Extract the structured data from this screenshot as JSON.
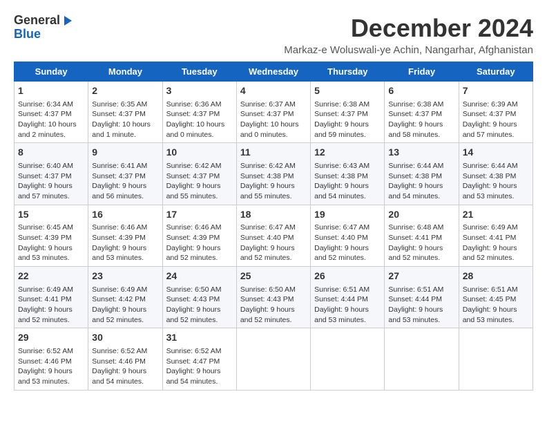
{
  "logo": {
    "general": "General",
    "blue": "Blue"
  },
  "header": {
    "month": "December 2024",
    "subtitle": "Markaz-e Woluswali-ye Achin, Nangarhar, Afghanistan"
  },
  "weekdays": [
    "Sunday",
    "Monday",
    "Tuesday",
    "Wednesday",
    "Thursday",
    "Friday",
    "Saturday"
  ],
  "weeks": [
    [
      {
        "day": "1",
        "sunrise": "6:34 AM",
        "sunset": "4:37 PM",
        "daylight": "10 hours and 2 minutes."
      },
      {
        "day": "2",
        "sunrise": "6:35 AM",
        "sunset": "4:37 PM",
        "daylight": "10 hours and 1 minute."
      },
      {
        "day": "3",
        "sunrise": "6:36 AM",
        "sunset": "4:37 PM",
        "daylight": "10 hours and 0 minutes."
      },
      {
        "day": "4",
        "sunrise": "6:37 AM",
        "sunset": "4:37 PM",
        "daylight": "10 hours and 0 minutes."
      },
      {
        "day": "5",
        "sunrise": "6:38 AM",
        "sunset": "4:37 PM",
        "daylight": "9 hours and 59 minutes."
      },
      {
        "day": "6",
        "sunrise": "6:38 AM",
        "sunset": "4:37 PM",
        "daylight": "9 hours and 58 minutes."
      },
      {
        "day": "7",
        "sunrise": "6:39 AM",
        "sunset": "4:37 PM",
        "daylight": "9 hours and 57 minutes."
      }
    ],
    [
      {
        "day": "8",
        "sunrise": "6:40 AM",
        "sunset": "4:37 PM",
        "daylight": "9 hours and 57 minutes."
      },
      {
        "day": "9",
        "sunrise": "6:41 AM",
        "sunset": "4:37 PM",
        "daylight": "9 hours and 56 minutes."
      },
      {
        "day": "10",
        "sunrise": "6:42 AM",
        "sunset": "4:37 PM",
        "daylight": "9 hours and 55 minutes."
      },
      {
        "day": "11",
        "sunrise": "6:42 AM",
        "sunset": "4:38 PM",
        "daylight": "9 hours and 55 minutes."
      },
      {
        "day": "12",
        "sunrise": "6:43 AM",
        "sunset": "4:38 PM",
        "daylight": "9 hours and 54 minutes."
      },
      {
        "day": "13",
        "sunrise": "6:44 AM",
        "sunset": "4:38 PM",
        "daylight": "9 hours and 54 minutes."
      },
      {
        "day": "14",
        "sunrise": "6:44 AM",
        "sunset": "4:38 PM",
        "daylight": "9 hours and 53 minutes."
      }
    ],
    [
      {
        "day": "15",
        "sunrise": "6:45 AM",
        "sunset": "4:39 PM",
        "daylight": "9 hours and 53 minutes."
      },
      {
        "day": "16",
        "sunrise": "6:46 AM",
        "sunset": "4:39 PM",
        "daylight": "9 hours and 53 minutes."
      },
      {
        "day": "17",
        "sunrise": "6:46 AM",
        "sunset": "4:39 PM",
        "daylight": "9 hours and 52 minutes."
      },
      {
        "day": "18",
        "sunrise": "6:47 AM",
        "sunset": "4:40 PM",
        "daylight": "9 hours and 52 minutes."
      },
      {
        "day": "19",
        "sunrise": "6:47 AM",
        "sunset": "4:40 PM",
        "daylight": "9 hours and 52 minutes."
      },
      {
        "day": "20",
        "sunrise": "6:48 AM",
        "sunset": "4:41 PM",
        "daylight": "9 hours and 52 minutes."
      },
      {
        "day": "21",
        "sunrise": "6:49 AM",
        "sunset": "4:41 PM",
        "daylight": "9 hours and 52 minutes."
      }
    ],
    [
      {
        "day": "22",
        "sunrise": "6:49 AM",
        "sunset": "4:41 PM",
        "daylight": "9 hours and 52 minutes."
      },
      {
        "day": "23",
        "sunrise": "6:49 AM",
        "sunset": "4:42 PM",
        "daylight": "9 hours and 52 minutes."
      },
      {
        "day": "24",
        "sunrise": "6:50 AM",
        "sunset": "4:43 PM",
        "daylight": "9 hours and 52 minutes."
      },
      {
        "day": "25",
        "sunrise": "6:50 AM",
        "sunset": "4:43 PM",
        "daylight": "9 hours and 52 minutes."
      },
      {
        "day": "26",
        "sunrise": "6:51 AM",
        "sunset": "4:44 PM",
        "daylight": "9 hours and 53 minutes."
      },
      {
        "day": "27",
        "sunrise": "6:51 AM",
        "sunset": "4:44 PM",
        "daylight": "9 hours and 53 minutes."
      },
      {
        "day": "28",
        "sunrise": "6:51 AM",
        "sunset": "4:45 PM",
        "daylight": "9 hours and 53 minutes."
      }
    ],
    [
      {
        "day": "29",
        "sunrise": "6:52 AM",
        "sunset": "4:46 PM",
        "daylight": "9 hours and 53 minutes."
      },
      {
        "day": "30",
        "sunrise": "6:52 AM",
        "sunset": "4:46 PM",
        "daylight": "9 hours and 54 minutes."
      },
      {
        "day": "31",
        "sunrise": "6:52 AM",
        "sunset": "4:47 PM",
        "daylight": "9 hours and 54 minutes."
      },
      null,
      null,
      null,
      null
    ]
  ]
}
